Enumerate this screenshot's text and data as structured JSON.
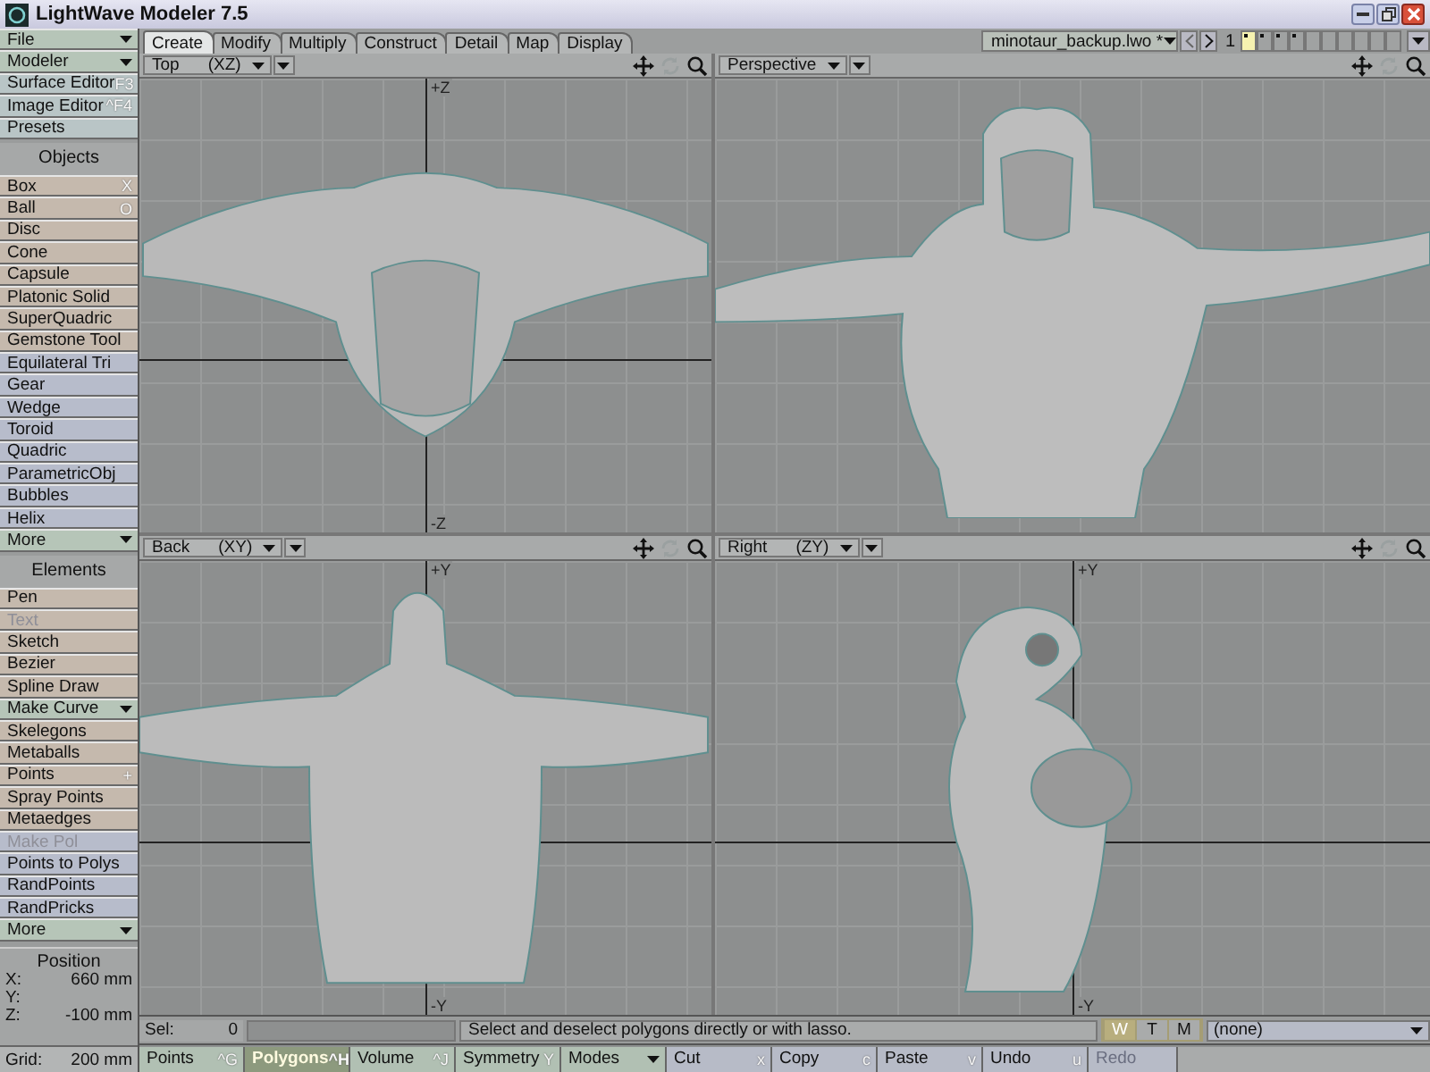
{
  "window": {
    "title": "LightWave Modeler 7.5"
  },
  "sidebar": {
    "top": [
      {
        "label": "File",
        "kind": "menu"
      },
      {
        "label": "Modeler",
        "kind": "menu"
      },
      {
        "label": "Surface Editor",
        "kind": "tool",
        "shortcut": "F3"
      },
      {
        "label": "Image Editor",
        "kind": "tool",
        "shortcut": "^F4"
      },
      {
        "label": "Presets",
        "kind": "tool"
      }
    ],
    "sections": [
      {
        "title": "Objects",
        "items": [
          {
            "label": "Box",
            "kind": "tool",
            "color": "#c5b9ad",
            "shortcut": "X",
            "disabled": false
          },
          {
            "label": "Ball",
            "kind": "tool",
            "color": "#c5b9ad",
            "shortcut": "O",
            "disabled": false
          },
          {
            "label": "Disc",
            "kind": "tool",
            "color": "#c5b9ad",
            "disabled": false
          },
          {
            "label": "Cone",
            "kind": "tool",
            "color": "#c5b9ad",
            "disabled": false
          },
          {
            "label": "Capsule",
            "kind": "tool",
            "color": "#c5b9ad",
            "disabled": false
          },
          {
            "label": "Platonic Solid",
            "kind": "tool",
            "color": "#c5b9ad",
            "disabled": false
          },
          {
            "label": "SuperQuadric",
            "kind": "tool",
            "color": "#c5b9ad",
            "disabled": false
          },
          {
            "label": "Gemstone Tool",
            "kind": "tool",
            "color": "#c5b9ad",
            "disabled": false
          },
          {
            "label": "Equilateral Tri",
            "kind": "tool",
            "color": "#b7bccb",
            "disabled": false
          },
          {
            "label": "Gear",
            "kind": "tool",
            "color": "#b7bccb",
            "disabled": false
          },
          {
            "label": "Wedge",
            "kind": "tool",
            "color": "#b7bccb",
            "disabled": false
          },
          {
            "label": "Toroid",
            "kind": "tool",
            "color": "#b7bccb",
            "disabled": false
          },
          {
            "label": "Quadric",
            "kind": "tool",
            "color": "#b7bccb",
            "disabled": false
          },
          {
            "label": "ParametricObj",
            "kind": "tool",
            "color": "#b7bccb",
            "disabled": false
          },
          {
            "label": "Bubbles",
            "kind": "tool",
            "color": "#b7bccb",
            "disabled": false
          },
          {
            "label": "Helix",
            "kind": "tool",
            "color": "#b7bccb",
            "disabled": false
          },
          {
            "label": "More",
            "kind": "menu",
            "color": "#b6c5b8",
            "disabled": false
          }
        ]
      },
      {
        "title": "Elements",
        "items": [
          {
            "label": "Pen",
            "kind": "tool",
            "color": "#c5b9ad",
            "disabled": false
          },
          {
            "label": "Text",
            "kind": "tool",
            "color": "#c5b9ad",
            "disabled": true
          },
          {
            "label": "Sketch",
            "kind": "tool",
            "color": "#c5b9ad",
            "disabled": false
          },
          {
            "label": "Bezier",
            "kind": "tool",
            "color": "#c5b9ad",
            "disabled": false
          },
          {
            "label": "Spline Draw",
            "kind": "tool",
            "color": "#c5b9ad",
            "disabled": false
          },
          {
            "label": "Make Curve",
            "kind": "menu",
            "color": "#b6c5b8",
            "disabled": false
          },
          {
            "label": "Skelegons",
            "kind": "tool",
            "color": "#c5b9ad",
            "disabled": false
          },
          {
            "label": "Metaballs",
            "kind": "tool",
            "color": "#c5b9ad",
            "disabled": false
          },
          {
            "label": "Points",
            "kind": "tool",
            "color": "#c5b9ad",
            "shortcut": "+",
            "disabled": false
          },
          {
            "label": "Spray Points",
            "kind": "tool",
            "color": "#c5b9ad",
            "disabled": false
          },
          {
            "label": "Metaedges",
            "kind": "tool",
            "color": "#c5b9ad",
            "disabled": false
          },
          {
            "label": "Make Pol",
            "kind": "tool",
            "color": "#b7bccb",
            "disabled": true
          },
          {
            "label": "Points to Polys",
            "kind": "tool",
            "color": "#b7bccb",
            "disabled": false
          },
          {
            "label": "RandPoints",
            "kind": "tool",
            "color": "#b7bccb",
            "disabled": false
          },
          {
            "label": "RandPricks",
            "kind": "tool",
            "color": "#b7bccb",
            "disabled": false
          },
          {
            "label": "More",
            "kind": "menu",
            "color": "#b6c5b8",
            "disabled": false
          }
        ]
      }
    ],
    "position": {
      "title": "Position",
      "rows": [
        {
          "axis": "X:",
          "value": "660 mm"
        },
        {
          "axis": "Y:"
        },
        {
          "axis": "Z:",
          "value": "-100 mm"
        }
      ]
    },
    "grid": {
      "label": "Grid:",
      "value": "200 mm"
    }
  },
  "tabs": [
    {
      "label": "Create",
      "selected": true
    },
    {
      "label": "Modify",
      "selected": false
    },
    {
      "label": "Multiply",
      "selected": false
    },
    {
      "label": "Construct",
      "selected": false
    },
    {
      "label": "Detail",
      "selected": false
    },
    {
      "label": "Map",
      "selected": false
    },
    {
      "label": "Display",
      "selected": false
    }
  ],
  "object_selector": {
    "value": "minotaur_backup.lwo *"
  },
  "layers": {
    "bank": "1",
    "items": [
      {
        "selected": true,
        "occupied": true
      },
      {
        "selected": false,
        "occupied": true
      },
      {
        "selected": false,
        "occupied": true
      },
      {
        "selected": false,
        "occupied": true
      },
      {
        "selected": false,
        "occupied": false
      },
      {
        "selected": false,
        "occupied": false
      },
      {
        "selected": false,
        "occupied": false
      },
      {
        "selected": false,
        "occupied": false
      },
      {
        "selected": false,
        "occupied": false
      },
      {
        "selected": false,
        "occupied": false
      }
    ]
  },
  "viewports": [
    {
      "view": "Top",
      "axes": "(XZ)",
      "top_label": "+Z",
      "bottom_label": "-Z",
      "kind": "top"
    },
    {
      "view": "Perspective",
      "kind": "perspective"
    },
    {
      "view": "Back",
      "axes": "(XY)",
      "top_label": "+Y",
      "bottom_label": "-Y",
      "kind": "front"
    },
    {
      "view": "Right",
      "axes": "(ZY)",
      "top_label": "+Y",
      "bottom_label": "-Y",
      "kind": "side"
    }
  ],
  "status": {
    "sel_label": "Sel:",
    "sel_value": "0",
    "message": "Select and deselect polygons directly or with lasso.",
    "modes": [
      {
        "label": "W",
        "selected": true
      },
      {
        "label": "T",
        "selected": false
      },
      {
        "label": "M",
        "selected": false
      }
    ],
    "surface": "(none)"
  },
  "toolbar": [
    {
      "label": "Points",
      "shortcut": "^G",
      "kind": "button",
      "selected": false,
      "disabled": false
    },
    {
      "label": "Polygons",
      "shortcut": "^H",
      "kind": "button",
      "selected": true,
      "disabled": false
    },
    {
      "label": "Volume",
      "shortcut": "^J",
      "kind": "button",
      "selected": false,
      "disabled": false
    },
    {
      "label": "Symmetry",
      "shortcut": "Y",
      "kind": "button",
      "selected": false,
      "disabled": false
    },
    {
      "label": "Modes",
      "kind": "menu",
      "selected": false,
      "disabled": false
    },
    {
      "label": "Cut",
      "shortcut": "x",
      "kind": "button",
      "selected": false,
      "disabled": false
    },
    {
      "label": "Copy",
      "shortcut": "c",
      "kind": "button",
      "selected": false,
      "disabled": false
    },
    {
      "label": "Paste",
      "shortcut": "v",
      "kind": "button",
      "selected": false,
      "disabled": false
    },
    {
      "label": "Undo",
      "shortcut": "u",
      "kind": "button",
      "selected": false,
      "disabled": false
    },
    {
      "label": "Redo",
      "kind": "button",
      "selected": false,
      "disabled": true
    }
  ]
}
